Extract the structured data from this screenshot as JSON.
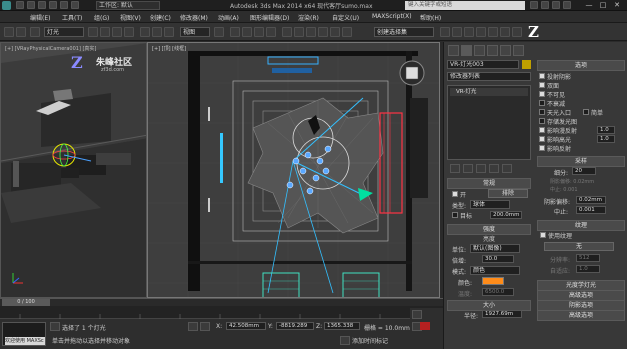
{
  "window": {
    "title": "Autodesk 3ds Max 2014 x64  现代客厅sumo.max",
    "workspace": "工作区: 默认",
    "search_placeholder": "键入关键字或短语",
    "min": "—",
    "max": "□",
    "close": "✕"
  },
  "menus": [
    "编辑(E)",
    "工具(T)",
    "组(G)",
    "视图(V)",
    "创建(C)",
    "修改器(M)",
    "动画(A)",
    "图形编辑器(D)",
    "渲染(R)",
    "自定义(U)",
    "MAXScript(X)",
    "帮助(H)"
  ],
  "toolbar": {
    "filter": "全部",
    "selection_set": "灯光",
    "view": "视图",
    "named_sel": "创建选择集"
  },
  "left_viewport": {
    "label": "[+] [VRayPhysicalCamera001] [真实]",
    "brand": "朱峰社区",
    "brand_url": "zf3d.com",
    "logo": "Z"
  },
  "main_viewport": {
    "label": "[+] [顶] [线框]"
  },
  "command_panel": {
    "object_name": "VR-灯光003",
    "modifier_list": "修改器列表",
    "stack_item": "VR-灯光",
    "general": {
      "header": "常规",
      "on_label": "开",
      "exclude_label": "排除",
      "type_label": "类型:",
      "type_value": "球体",
      "target_label": "目标",
      "target_value": "200.0mm"
    },
    "intensity": {
      "header": "强度",
      "units_label": "单位:",
      "units_value": "默认(图像)",
      "mult_label": "倍增:",
      "mult_value": "30.0",
      "mode_label": "模式:",
      "mode_value": "颜色",
      "color_label": "颜色:",
      "temp_label": "温度:",
      "temp_value": "6500.0",
      "color": "#ff8c1a"
    },
    "size": {
      "header": "大小",
      "radius_label": "半径:",
      "radius_value": "1927.69m"
    },
    "options": {
      "header": "选项",
      "items": [
        {
          "label": "投射阴影",
          "checked": true
        },
        {
          "label": "双面",
          "checked": true
        },
        {
          "label": "不可见",
          "checked": true
        },
        {
          "label": "不衰减",
          "checked": false
        },
        {
          "label": "天光入口",
          "checked": false
        },
        {
          "label": "存储发光图",
          "checked": false
        },
        {
          "label": "影响漫反射",
          "checked": true
        },
        {
          "label": "影响高光",
          "checked": true
        },
        {
          "label": "影响反射",
          "checked": true
        }
      ],
      "simple_label": "简单",
      "diffuse_val": "1.0",
      "specular_val": "1.0"
    },
    "sampling": {
      "header": "采样",
      "subdivs_label": "细分:",
      "subdivs_value": "20",
      "shadow_bias_label": "阴影偏移:",
      "shadow_bias_value": "0.02mm",
      "cutoff_label": "中止:",
      "cutoff_value": "0.001",
      "row1": "阴影偏移: 0.02mm",
      "row2": "中止: 0.001"
    },
    "texture": {
      "header": "纹理",
      "use_texture": "使用纹理",
      "none": "无",
      "resolution_label": "分辨率:",
      "resolution_value": "512",
      "adaptive_label": "自适应:",
      "adaptive_value": "1.0"
    },
    "rollouts": [
      "光度学灯光",
      "高级选项",
      "阴影选项",
      "高级选项"
    ]
  },
  "timeline": {
    "frame": "0 / 100"
  },
  "status": {
    "selected": "选择了 1 个灯光",
    "hint": "单击并拖动以选择并移动对象",
    "x_label": "X:",
    "x_value": "42.508mm",
    "y_label": "Y:",
    "y_value": "-8819.289",
    "z_label": "Z:",
    "z_value": "1365.338",
    "grid": "栅格 = 10.0mm",
    "autokey": "自动关键点",
    "selected_obj": "选定对象",
    "setkey": "设置关键点",
    "keyfilter": "关键点过滤器...",
    "add_time": "添加时间标记",
    "maxscript": "欢迎使用 MAXSc",
    "frame_value": "0"
  }
}
